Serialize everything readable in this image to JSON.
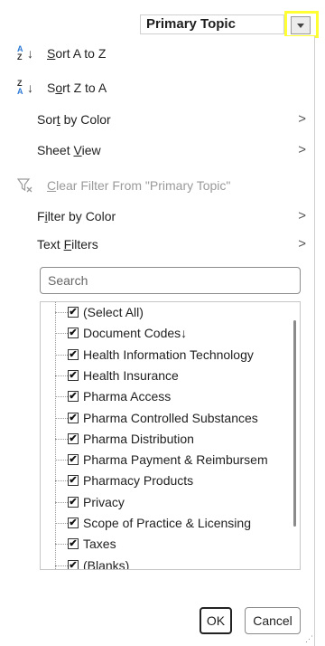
{
  "header": {
    "column_title": "Primary Topic"
  },
  "menu": {
    "sort_az": {
      "pre": "",
      "key": "S",
      "post": "ort A to Z"
    },
    "sort_za": {
      "pre": "S",
      "key": "o",
      "post": "rt Z to A"
    },
    "sort_color": {
      "pre": "Sor",
      "key": "t",
      "post": " by Color"
    },
    "sheet_view": {
      "pre": "Sheet ",
      "key": "V",
      "post": "iew"
    },
    "clear_filter": {
      "pre": "",
      "key": "C",
      "post": "lear Filter From \"Primary Topic\""
    },
    "filter_color": {
      "pre": "F",
      "key": "i",
      "post": "lter by Color"
    },
    "text_filters": {
      "pre": "Text ",
      "key": "F",
      "post": "ilters"
    },
    "chevron": ">"
  },
  "search": {
    "placeholder": "Search"
  },
  "list": {
    "items": [
      "(Select All)",
      "Document Codes↓",
      "Health Information Technology",
      "Health Insurance",
      "Pharma Access",
      "Pharma Controlled Substances",
      "Pharma Distribution",
      "Pharma Payment & Reimbursem",
      "Pharmacy Products",
      "Privacy",
      "Scope of Practice & Licensing",
      "Taxes",
      "(Blanks)"
    ],
    "checkmark": "✔"
  },
  "buttons": {
    "ok": "OK",
    "cancel": "Cancel"
  },
  "colors": {
    "highlight": "#ffff33",
    "sort_icon": "#2b78d4",
    "disabled_text": "#9a9a9a"
  },
  "icons": {
    "sort_az": "sort-ascending-icon",
    "sort_za": "sort-descending-icon",
    "clear_filter": "clear-filter-icon",
    "dropdown": "dropdown-arrow-icon",
    "grip": "resize-grip-icon"
  }
}
